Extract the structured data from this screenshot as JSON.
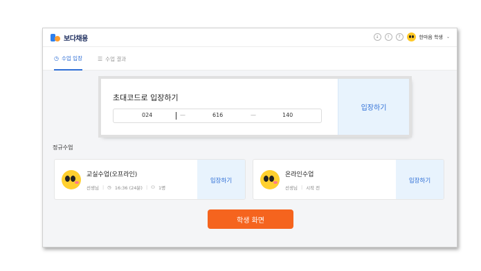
{
  "app": {
    "logo_text": "보다채용"
  },
  "header": {
    "icons": [
      "download-icon",
      "notice-icon",
      "help-icon"
    ],
    "user_name": "한마음 학생",
    "chevron": "⌄"
  },
  "tabs": [
    {
      "label": "수업 입장",
      "icon": "clock-icon",
      "active": true
    },
    {
      "label": "수업 결과",
      "icon": "list-icon",
      "active": false
    }
  ],
  "invite": {
    "title": "초대코드로 입장하기",
    "code": [
      "024",
      "616",
      "140"
    ],
    "separator": "—",
    "enter_label": "입장하기"
  },
  "regular": {
    "section_title": "정규수업",
    "classes": [
      {
        "title": "교실수업(오프라인)",
        "teacher": "선생님",
        "time": "16:36 (24분)",
        "people": "1명",
        "enter_label": "입장하기"
      },
      {
        "title": "온라인수업",
        "teacher": "선생님",
        "status": "시작 전",
        "enter_label": "입장하기"
      }
    ]
  },
  "footer": {
    "student_screen_label": "학생 화면"
  },
  "colors": {
    "accent": "#2f6fd6",
    "cta": "#f5641e",
    "enter_bg": "#e8f3fd"
  }
}
